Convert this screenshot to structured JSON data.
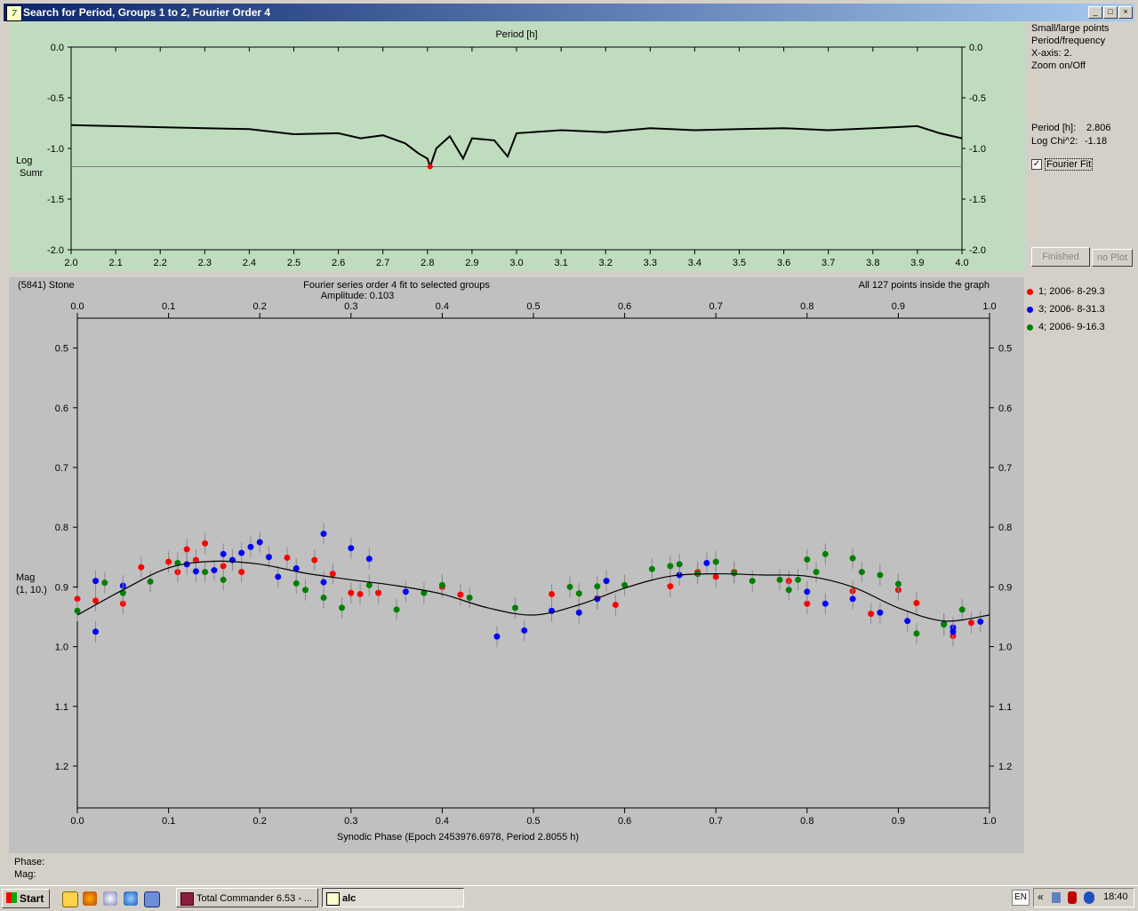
{
  "window": {
    "title": "Search for Period, Groups 1 to 2, Fourier Order 4",
    "app_icon_text": "7",
    "minimize": "_",
    "maximize": "□",
    "close": "×"
  },
  "top_chart": {
    "label_top": "Period [h]",
    "ylabel_line1": "Log",
    "ylabel_line2": "Sumr",
    "ytick_labels": [
      "0.0",
      "-0.5",
      "-1.0",
      "-1.5",
      "-2.0"
    ],
    "xtick_labels": [
      "2.0",
      "2.1",
      "2.2",
      "2.3",
      "2.4",
      "2.5",
      "2.6",
      "2.7",
      "2.8",
      "2.9",
      "3.0",
      "3.1",
      "3.2",
      "3.3",
      "3.4",
      "3.5",
      "3.6",
      "3.7",
      "3.8",
      "3.9",
      "4.0"
    ]
  },
  "side": {
    "option1": "Small/large points",
    "option2": "Period/frequency",
    "option3": "X-axis: 2.",
    "option4": "Zoom on/Off",
    "period_label": "Period [h]:",
    "period_value": "2.806",
    "chi_label": "Log Chi^2:",
    "chi_value": "-1.18",
    "fourier_label": "Fourier Fit",
    "fourier_checked": true,
    "finished_label": "Finished",
    "noplot_label": "no Plot"
  },
  "bottom_chart": {
    "object_label": "(5841) Stone",
    "fit_label": "Fourier series order 4 fit to selected groups",
    "amplitude_label": "Amplitude: 0.103",
    "points_label": "All 127 points inside the graph",
    "ylabel_line1": "Mag",
    "ylabel_line2": "(1, 10.)",
    "xlabel": "Synodic Phase (Epoch 2453976.6978, Period 2.8055 h)",
    "ytick_labels": [
      "0.5",
      "0.6",
      "0.7",
      "0.8",
      "0.9",
      "1.0",
      "1.1",
      "1.2"
    ],
    "xtick_labels": [
      "0.0",
      "0.1",
      "0.2",
      "0.3",
      "0.4",
      "0.5",
      "0.6",
      "0.7",
      "0.8",
      "0.9",
      "1.0"
    ]
  },
  "legend": [
    {
      "label": "1; 2006- 8-29.3",
      "color": "#ff0000"
    },
    {
      "label": "3; 2006- 8-31.3",
      "color": "#0000ff"
    },
    {
      "label": "4; 2006- 9-16.3",
      "color": "#008000"
    }
  ],
  "status": {
    "phase": "Phase:",
    "mag": "Mag:"
  },
  "taskbar": {
    "start": "Start",
    "task1": "Total Commander 6.53 - ...",
    "task2": "alc",
    "lang": "EN",
    "clock": "18:40"
  },
  "chart_data": [
    {
      "type": "line",
      "title": "",
      "xlabel": "Period [h]",
      "ylabel": "Log Sumr",
      "xlim": [
        2.0,
        4.0
      ],
      "ylim": [
        -2.0,
        0.0
      ],
      "best_period": 2.806,
      "best_value": -1.18,
      "reference_line": -1.18,
      "series": [
        {
          "name": "",
          "x": [
            2.0,
            2.1,
            2.2,
            2.3,
            2.4,
            2.5,
            2.6,
            2.65,
            2.7,
            2.75,
            2.78,
            2.8,
            2.806,
            2.82,
            2.85,
            2.88,
            2.9,
            2.95,
            2.98,
            3.0,
            3.1,
            3.2,
            3.3,
            3.4,
            3.5,
            3.6,
            3.7,
            3.8,
            3.9,
            3.95,
            4.0
          ],
          "y": [
            -0.77,
            -0.78,
            -0.79,
            -0.8,
            -0.81,
            -0.86,
            -0.85,
            -0.9,
            -0.87,
            -0.95,
            -1.05,
            -1.1,
            -1.18,
            -1.0,
            -0.88,
            -1.1,
            -0.9,
            -0.92,
            -1.08,
            -0.85,
            -0.82,
            -0.84,
            -0.8,
            -0.82,
            -0.81,
            -0.8,
            -0.82,
            -0.8,
            -0.78,
            -0.85,
            -0.9
          ]
        }
      ]
    },
    {
      "type": "scatter",
      "title": "Fourier series order 4 fit to selected groups",
      "xlabel": "Synodic Phase (Epoch 2453976.6978, Period 2.8055 h)",
      "ylabel": "Mag (1, 10.)",
      "xlim": [
        0.0,
        1.0
      ],
      "ylim": [
        1.27,
        0.45
      ],
      "grid": false,
      "legend": "right",
      "fit_curve": {
        "x": [
          0.0,
          0.05,
          0.1,
          0.15,
          0.2,
          0.25,
          0.3,
          0.35,
          0.4,
          0.45,
          0.5,
          0.55,
          0.6,
          0.65,
          0.7,
          0.75,
          0.8,
          0.85,
          0.9,
          0.95,
          1.0
        ],
        "y": [
          0.947,
          0.905,
          0.868,
          0.857,
          0.862,
          0.877,
          0.888,
          0.898,
          0.912,
          0.935,
          0.947,
          0.93,
          0.902,
          0.882,
          0.878,
          0.88,
          0.882,
          0.9,
          0.935,
          0.957,
          0.947
        ]
      },
      "series": [
        {
          "name": "1; 2006- 8-29.3",
          "color": "#ff0000",
          "x": [
            0.0,
            0.02,
            0.05,
            0.07,
            0.1,
            0.11,
            0.12,
            0.13,
            0.14,
            0.16,
            0.18,
            0.23,
            0.26,
            0.28,
            0.3,
            0.31,
            0.33,
            0.4,
            0.42,
            0.52,
            0.57,
            0.59,
            0.65,
            0.68,
            0.7,
            0.72,
            0.78,
            0.8,
            0.85,
            0.87,
            0.9,
            0.92,
            0.96,
            0.98
          ],
          "y": [
            0.92,
            0.923,
            0.928,
            0.867,
            0.858,
            0.875,
            0.837,
            0.855,
            0.827,
            0.865,
            0.875,
            0.851,
            0.855,
            0.878,
            0.91,
            0.912,
            0.91,
            0.9,
            0.913,
            0.912,
            0.919,
            0.93,
            0.899,
            0.875,
            0.883,
            0.875,
            0.89,
            0.928,
            0.907,
            0.945,
            0.905,
            0.927,
            0.982,
            0.96
          ]
        },
        {
          "name": "3; 2006- 8-31.3",
          "color": "#0000ff",
          "x": [
            0.02,
            0.02,
            0.05,
            0.12,
            0.13,
            0.15,
            0.16,
            0.17,
            0.18,
            0.19,
            0.2,
            0.21,
            0.22,
            0.24,
            0.27,
            0.27,
            0.3,
            0.32,
            0.36,
            0.46,
            0.49,
            0.52,
            0.55,
            0.57,
            0.58,
            0.66,
            0.69,
            0.8,
            0.82,
            0.85,
            0.88,
            0.91,
            0.95,
            0.96,
            0.96,
            0.99
          ],
          "y": [
            0.89,
            0.975,
            0.898,
            0.862,
            0.874,
            0.872,
            0.845,
            0.855,
            0.843,
            0.833,
            0.825,
            0.85,
            0.883,
            0.869,
            0.811,
            0.892,
            0.835,
            0.853,
            0.908,
            0.983,
            0.973,
            0.94,
            0.943,
            0.92,
            0.89,
            0.88,
            0.86,
            0.908,
            0.928,
            0.92,
            0.943,
            0.957,
            0.962,
            0.968,
            0.975,
            0.958
          ]
        },
        {
          "name": "4; 2006- 9-16.3",
          "color": "#008000",
          "x": [
            0.0,
            0.03,
            0.05,
            0.08,
            0.11,
            0.14,
            0.16,
            0.24,
            0.25,
            0.27,
            0.29,
            0.32,
            0.35,
            0.38,
            0.4,
            0.43,
            0.48,
            0.54,
            0.55,
            0.57,
            0.6,
            0.63,
            0.65,
            0.66,
            0.68,
            0.7,
            0.72,
            0.74,
            0.77,
            0.78,
            0.79,
            0.8,
            0.81,
            0.82,
            0.85,
            0.86,
            0.88,
            0.9,
            0.92,
            0.95,
            0.97
          ],
          "y": [
            0.94,
            0.893,
            0.91,
            0.891,
            0.86,
            0.875,
            0.888,
            0.894,
            0.905,
            0.918,
            0.935,
            0.897,
            0.938,
            0.91,
            0.897,
            0.918,
            0.935,
            0.9,
            0.911,
            0.899,
            0.897,
            0.87,
            0.865,
            0.862,
            0.878,
            0.858,
            0.877,
            0.89,
            0.888,
            0.905,
            0.888,
            0.854,
            0.875,
            0.845,
            0.852,
            0.875,
            0.88,
            0.895,
            0.978,
            0.963,
            0.938
          ]
        }
      ]
    }
  ]
}
